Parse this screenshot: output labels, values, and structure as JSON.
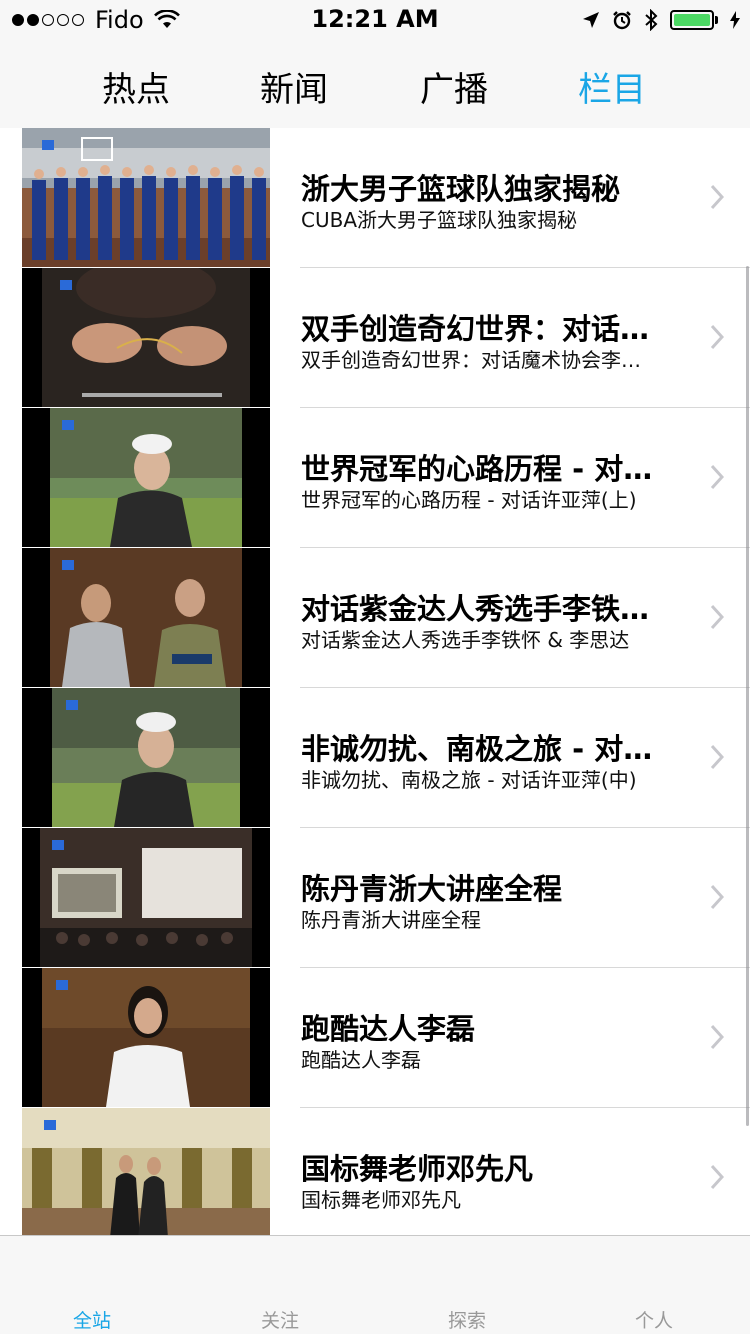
{
  "status_bar": {
    "carrier": "Fido",
    "time": "12:21 AM",
    "signal_bars_filled": 2,
    "signal_bars_total": 5,
    "battery_level": 1.0,
    "icons": [
      "wifi-icon",
      "location-arrow-icon",
      "alarm-icon",
      "bluetooth-icon",
      "battery-icon",
      "charging-bolt-icon"
    ]
  },
  "top_tabs": [
    {
      "label": "热点",
      "active": false
    },
    {
      "label": "新闻",
      "active": false
    },
    {
      "label": "广播",
      "active": false
    },
    {
      "label": "栏目",
      "active": true
    }
  ],
  "list": [
    {
      "title": "浙大男子篮球队独家揭秘",
      "subtitle": "CUBA浙大男子篮球队独家揭秘"
    },
    {
      "title": "双手创造奇幻世界：对话…",
      "subtitle": "双手创造奇幻世界：对话魔术协会李…"
    },
    {
      "title": "世界冠军的心路历程 - 对…",
      "subtitle": "世界冠军的心路历程 - 对话许亚萍(上)"
    },
    {
      "title": "对话紫金达人秀选手李铁…",
      "subtitle": "对话紫金达人秀选手李铁怀 & 李思达"
    },
    {
      "title": "非诚勿扰、南极之旅 - 对…",
      "subtitle": "非诚勿扰、南极之旅 - 对话许亚萍(中)"
    },
    {
      "title": "陈丹青浙大讲座全程",
      "subtitle": "陈丹青浙大讲座全程"
    },
    {
      "title": "跑酷达人李磊",
      "subtitle": "跑酷达人李磊"
    },
    {
      "title": "国标舞老师邓先凡",
      "subtitle": "国标舞老师邓先凡"
    }
  ],
  "bottom_tabs": [
    {
      "label": "全站",
      "active": true
    },
    {
      "label": "关注",
      "active": false
    },
    {
      "label": "探索",
      "active": false
    },
    {
      "label": "个人",
      "active": false
    }
  ],
  "colors": {
    "accent": "#1aa6e6",
    "battery": "#4cd964"
  }
}
